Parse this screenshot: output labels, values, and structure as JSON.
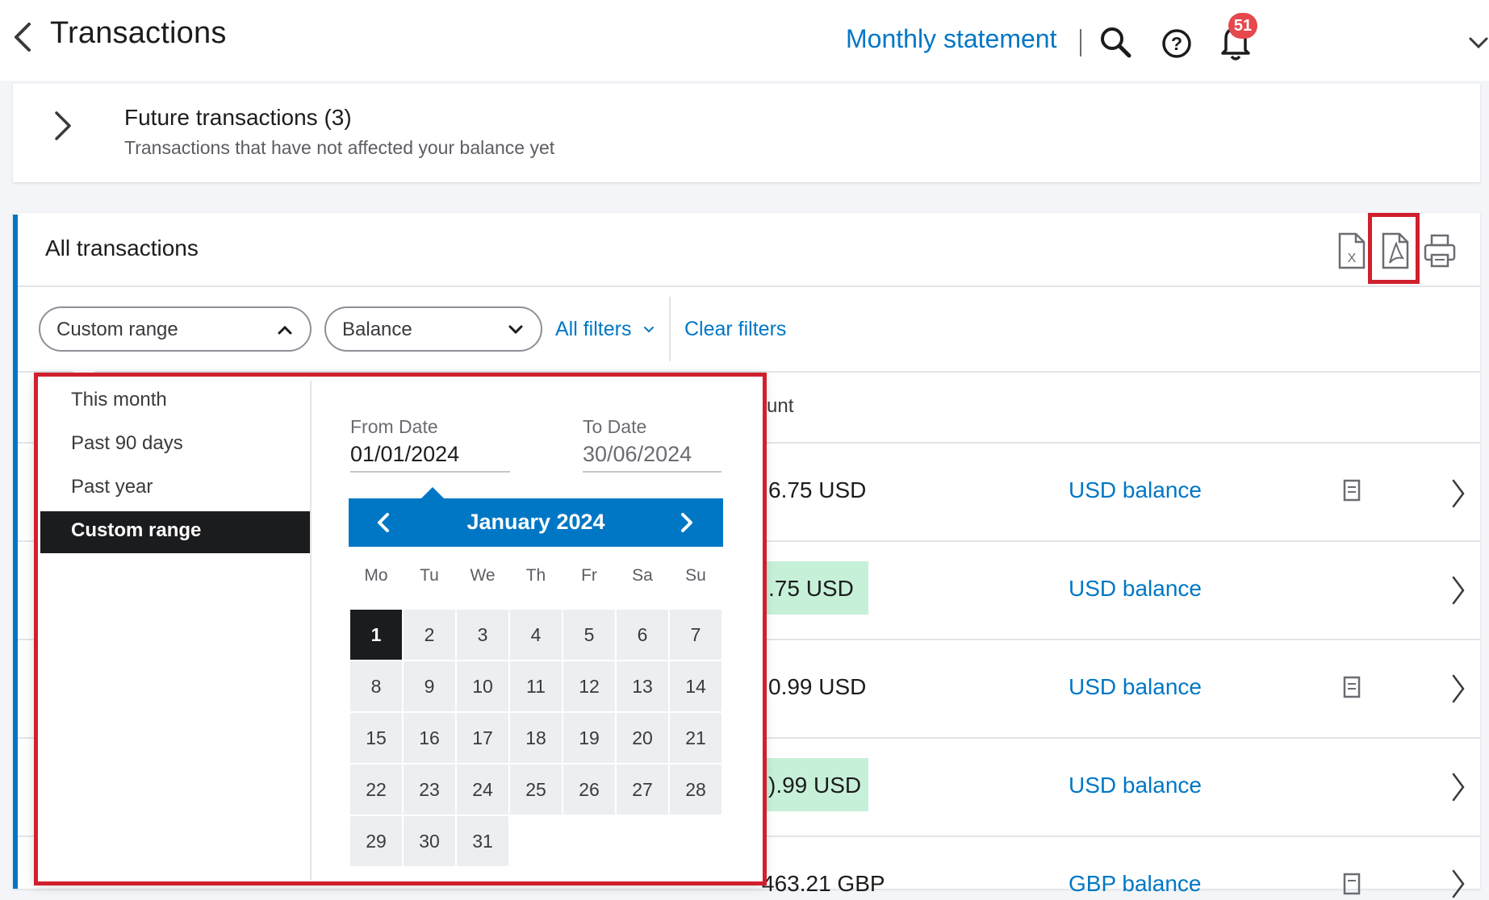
{
  "header": {
    "title": "Transactions",
    "monthly_statement": "Monthly statement",
    "notification_count": "51"
  },
  "future": {
    "title": "Future transactions (3)",
    "subtitle": "Transactions that have not affected your balance yet"
  },
  "panel": {
    "title": "All transactions"
  },
  "filters": {
    "date_filter_value": "Custom range",
    "balance_filter_value": "Balance",
    "all_filters": "All filters",
    "clear_filters": "Clear filters"
  },
  "table": {
    "amount_header_partial": "unt",
    "rows": [
      {
        "amount": "6.75 USD",
        "balance": "USD balance",
        "highlight": false,
        "attachment": true
      },
      {
        "amount": ".75 USD",
        "balance": "USD balance",
        "highlight": true,
        "attachment": false
      },
      {
        "amount": "0.99 USD",
        "balance": "USD balance",
        "highlight": false,
        "attachment": true
      },
      {
        "amount": ").99 USD",
        "balance": "USD balance",
        "highlight": true,
        "attachment": false
      },
      {
        "amount": "463.21 GBP",
        "balance": "GBP balance",
        "highlight": false,
        "attachment": true
      }
    ]
  },
  "date_dropdown": {
    "options": [
      "This month",
      "Past 90 days",
      "Past year",
      "Custom range"
    ],
    "selected_option": "Custom range",
    "from_label": "From Date",
    "from_value": "01/01/2024",
    "to_label": "To Date",
    "to_value": "30/06/2024",
    "calendar": {
      "month_label": "January 2024",
      "weekdays": [
        "Mo",
        "Tu",
        "We",
        "Th",
        "Fr",
        "Sa",
        "Su"
      ],
      "days": [
        "1",
        "2",
        "3",
        "4",
        "5",
        "6",
        "7",
        "8",
        "9",
        "10",
        "11",
        "12",
        "13",
        "14",
        "15",
        "16",
        "17",
        "18",
        "19",
        "20",
        "21",
        "22",
        "23",
        "24",
        "25",
        "26",
        "27",
        "28",
        "29",
        "30",
        "31"
      ],
      "selected_day": "1"
    }
  },
  "colors": {
    "accent": "#0077c5",
    "highlight_border": "#d0202e",
    "selected_dark": "#1b1c1e",
    "amount_highlight": "#c7f0d8",
    "badge": "#e5484d"
  }
}
